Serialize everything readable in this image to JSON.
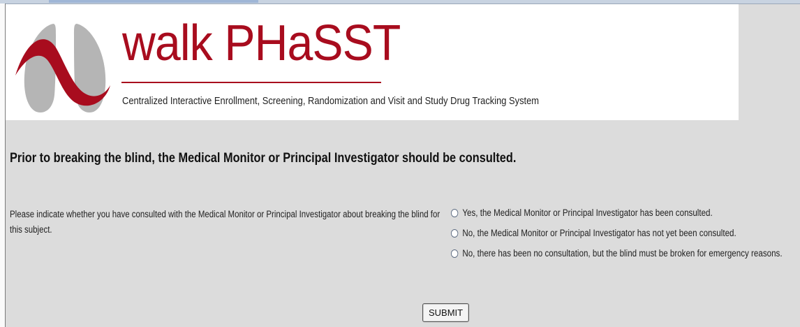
{
  "header": {
    "brand": "walk PHaSST",
    "subtitle": "Centralized Interactive Enrollment, Screening, Randomization and Visit and Study Drug Tracking System"
  },
  "main": {
    "heading": "Prior to breaking the blind, the Medical Monitor or Principal Investigator should be consulted.",
    "question": "Please indicate whether you have consulted with the Medical Monitor or Principal Investigator about breaking the blind for this subject.",
    "options": [
      "Yes, the Medical Monitor or Principal Investigator has been consulted.",
      "No, the Medical Monitor or Principal Investigator has not yet been consulted.",
      "No, there has been no consultation, but the blind must be broken for emergency reasons."
    ],
    "submit_label": "SUBMIT"
  },
  "colors": {
    "brand": "#a80c1e",
    "background": "#dcdcdc",
    "logo_gray": "#b5b5b5"
  }
}
